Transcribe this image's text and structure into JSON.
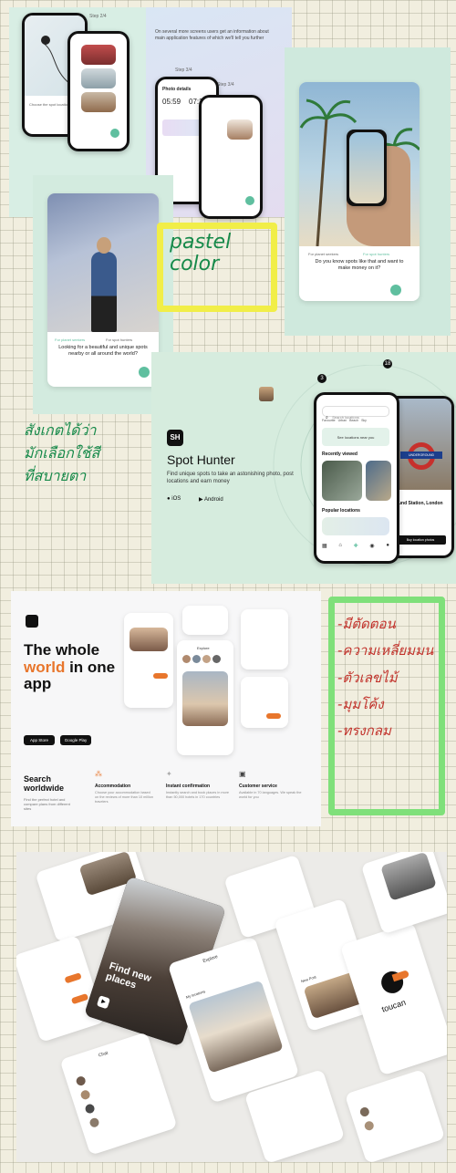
{
  "section1": {
    "steps": [
      "Step 2/4",
      "Step 3/4",
      "Step 3/4"
    ],
    "intro_text": "On several more screens users get an information about main application features of which we'll tell you further",
    "photo_details_title": "Photo details",
    "times": [
      "05:59",
      "07:37"
    ],
    "card_question": "Do you know spots like that and want to make money on it?",
    "card_tabs": [
      "For planet seekers",
      "For spot hunters"
    ],
    "card_looking": "Looking for a beautiful and unique spots nearby or all around the world?",
    "handwriting": "pastel color"
  },
  "section2": {
    "handwriting_lines": [
      "สังเกตได้ว่า",
      "มักเลือกใช้สี",
      "ที่สบายตา"
    ],
    "app_name": "Spot Hunter",
    "logo_text": "SH",
    "tagline": "Find unique spots to take an astonishing photo, post locations and earn money",
    "platforms": [
      "iOS",
      "Android"
    ],
    "search_placeholder": "Search locations",
    "filters": [
      "Favourite",
      "Urban",
      "Beach",
      "Sky"
    ],
    "see_locations": "See locations near you",
    "recently_viewed": "Recently viewed",
    "popular_locations": "Popular locations",
    "station_label": "UNDERGROUND",
    "station_name": "rground Station, London",
    "buy_button": "Buy location photos",
    "markers": [
      "3",
      "18"
    ]
  },
  "section3": {
    "headline_1": "The whole",
    "headline_accent": "world",
    "headline_2": "in one",
    "headline_3": "app",
    "store_buttons": [
      "App Store",
      "Google Play"
    ],
    "search_title": "Search worldwide",
    "search_sub": "Find the perfect hotel and compare plans from different sites",
    "features": [
      {
        "title": "Accommodation",
        "text": "Choose your accommodation based on the reviews of more than 10 million travelers"
      },
      {
        "title": "Instant confirmation",
        "text": "Instantly search and book places in more than 50,000 hotels in 170 countries"
      },
      {
        "title": "Customer service",
        "text": "Available in 70 languages. We speak the world for you"
      }
    ],
    "handwriting_lines": [
      "-มีตัดตอน",
      "-ความเหลี่ยมมน",
      "-ตัวเลขไม้",
      "-มุมโค้ง",
      "-ทรงกลม"
    ],
    "phone_title": "Explore"
  },
  "section4": {
    "find_new_places": "Find new places",
    "brand": "toucan",
    "explore": "Explore",
    "chat": "Chat",
    "my_locations": "My locations",
    "new_post": "New Post"
  },
  "colors": {
    "mint": "#d7ede3",
    "lavender": "#dcdcef",
    "accent_green": "#5fbf9f",
    "orange": "#e8762c",
    "highlight_yellow": "#f3f04c",
    "highlight_green": "#7fe07a"
  }
}
